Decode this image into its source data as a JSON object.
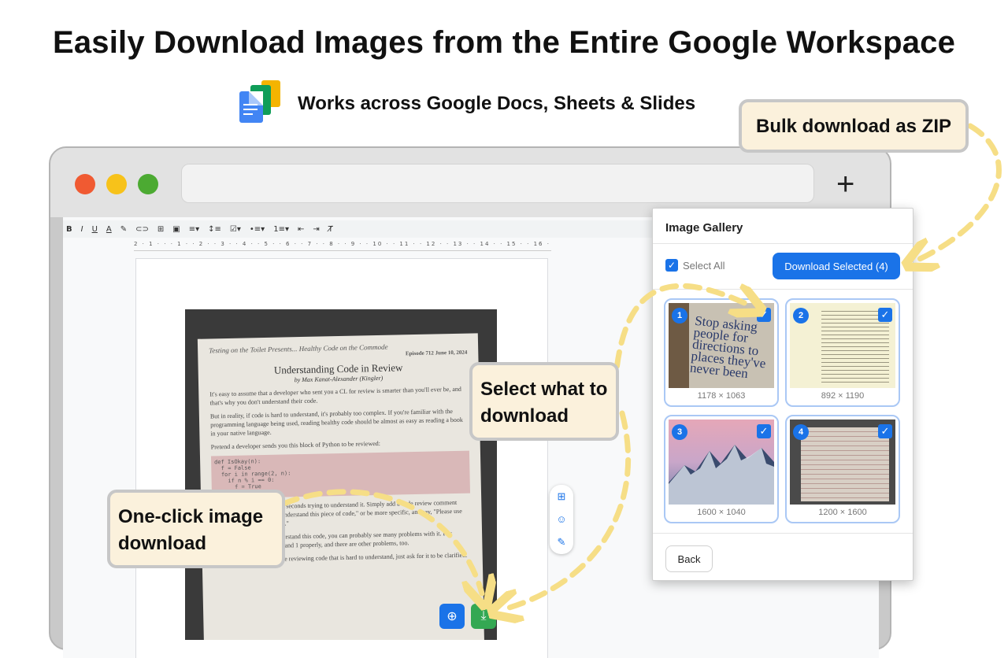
{
  "headline": "Easily Download Images from the Entire Google Workspace",
  "subheadline": "Works across Google Docs, Sheets & Slides",
  "callouts": {
    "zip": "Bulk download as ZIP",
    "select": "Select what to download",
    "one_click": "One-click image download"
  },
  "gallery": {
    "title": "Image Gallery",
    "select_all": "Select All",
    "download_selected": "Download Selected (4)",
    "back": "Back",
    "items": [
      {
        "num": "1",
        "dims": "1178 × 1063",
        "thumb_text": "Stop asking people for directions to places they've never been"
      },
      {
        "num": "2",
        "dims": "892 × 1190"
      },
      {
        "num": "3",
        "dims": "1600 × 1040"
      },
      {
        "num": "4",
        "dims": "1200 × 1600"
      }
    ]
  },
  "doc": {
    "paper_header": "Testing on the Toilet Presents... Healthy Code on the Commode",
    "episode": "Episode 712 June 10, 2024",
    "paper_title": "Understanding Code in Review",
    "paper_byline": "by Max Kanat-Alexander (Kingler)",
    "p1": "It's easy to assume that a developer who sent you a CL for review is smarter than you'll ever be, and that's why you don't understand their code.",
    "p2": "But in reality, if code is hard to understand, it's probably too complex. If you're familiar with the programming language being used, reading healthy code should be almost as easy as reading a book in your native language.",
    "p3": "Pretend a developer sends you this block of Python to be reviewed:",
    "code": "def IsOkay(n):\n  f = False\n  for i in range(2, n):\n    if n % i == 0:\n      f = True\n  return not f",
    "p4": "Don't spend more than a few seconds trying to understand it. Simply add a code review comment saying, \"It's hard for me to understand this piece of code,\" or be more specific, and say, \"Please use more descriptive names here.\"",
    "p5": "Now that we can easily understand this code, you can probably see many problems with it. For example, it doesn't handle 0 and 1 properly, and there are other problems, too.",
    "p6": "In summary, don't waste time reviewing code that is hard to understand, just ask for it to be clarified."
  },
  "colors": {
    "accent": "#1a73e8",
    "callout_bg": "#fbf1dc",
    "arrow": "#f6de86",
    "download_green": "#34a853",
    "traffic_red": "#f05a32",
    "traffic_yellow": "#f7c21a",
    "traffic_green": "#4caa32"
  }
}
